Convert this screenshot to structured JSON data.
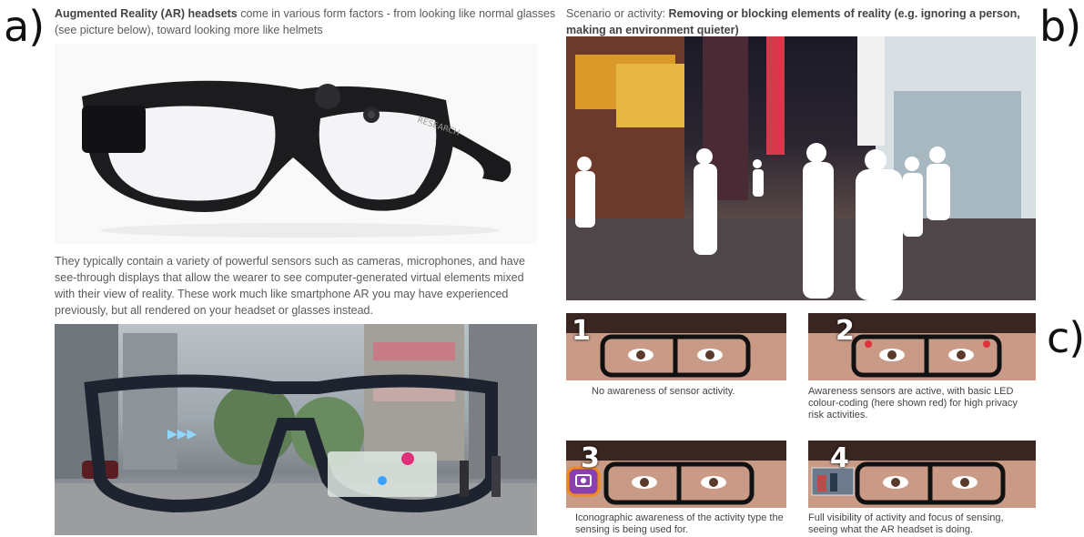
{
  "labels": {
    "a": "a)",
    "b": "b)",
    "c": "c)"
  },
  "panel_a": {
    "intro_bold": "Augmented Reality (AR) headsets",
    "intro_rest": " come in various form factors - from looking like normal glasses (see picture below), toward looking more like helmets",
    "glasses_brand": "RESEARCH",
    "sensors_text": "They typically contain a variety of powerful sensors such as cameras, microphones, and have see-through displays that allow the wearer to see computer-generated virtual elements mixed with their view of reality. These work much like smartphone AR you may have experienced previously, but all rendered on your headset or glasses instead."
  },
  "panel_b": {
    "scenario_prefix": "Scenario or activity: ",
    "scenario_bold": "Removing or blocking elements of reality (e.g. ignoring a person, making an environment quieter)"
  },
  "panel_c": {
    "items": [
      {
        "number": "1",
        "caption": "No awareness of sensor activity."
      },
      {
        "number": "2",
        "caption": "Awareness sensors are active, with basic LED colour-coding (here shown red) for high privacy risk activities."
      },
      {
        "number": "3",
        "caption": "Iconographic awareness of the activity type the sensing is being used for."
      },
      {
        "number": "4",
        "caption": "Full visibility of activity and focus of sensing, seeing what the AR headset is doing."
      }
    ]
  },
  "colors": {
    "led_red": "#e0303a",
    "camera_badge": "#8a3fb0",
    "badge_ring": "#f08a1a"
  }
}
